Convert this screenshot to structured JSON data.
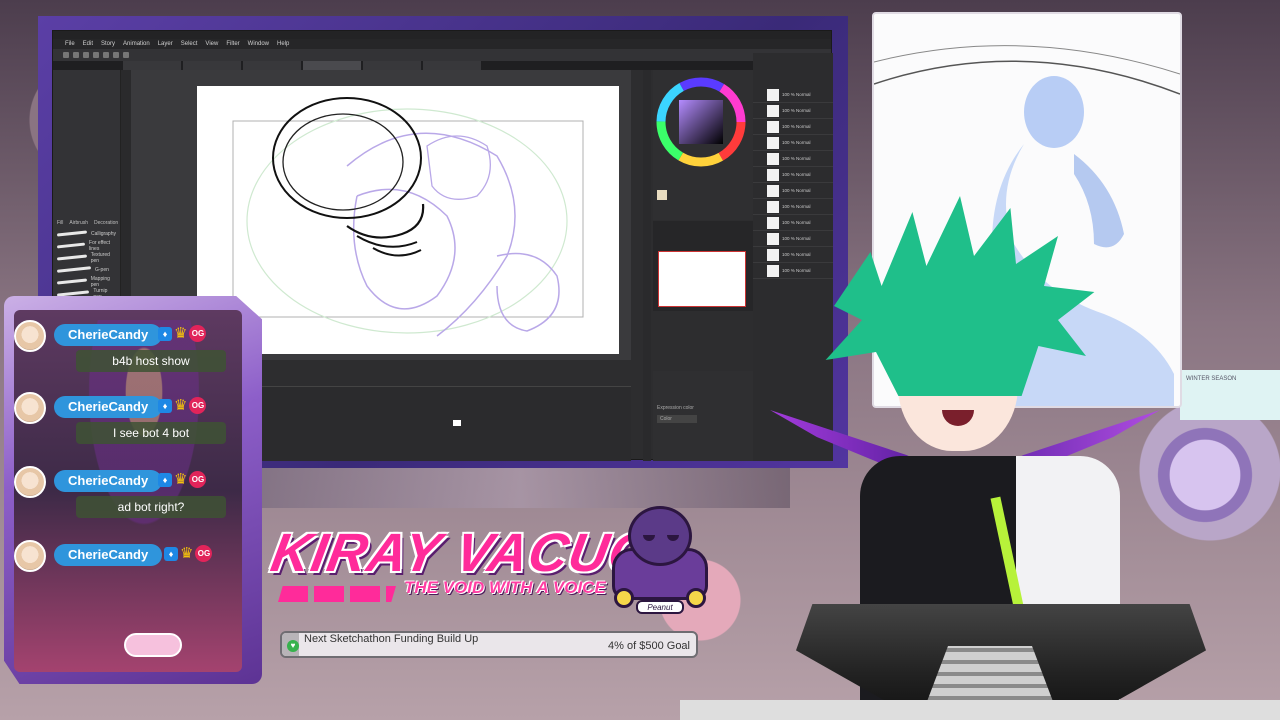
{
  "app": {
    "menu": [
      "File",
      "Edit",
      "Story",
      "Animation",
      "Layer",
      "Select",
      "View",
      "Filter",
      "Window",
      "Help"
    ],
    "tool_property": [
      "Fill",
      "Airbrush",
      "Decoration"
    ],
    "brushes": [
      "Calligraphy",
      "For effect lines",
      "Textured pen",
      "G-pen",
      "Mapping pen",
      "Turnip pen"
    ],
    "layer_row_text": "100 % Normal",
    "property_title": "Expression color",
    "property_value": "Color"
  },
  "chat": {
    "messages": [
      {
        "user": "CherieCandy",
        "text": "b4b host show"
      },
      {
        "user": "CherieCandy",
        "text": "I see bot 4 bot"
      },
      {
        "user": "CherieCandy",
        "text": "ad bot right?"
      },
      {
        "user": "CherieCandy",
        "text": ""
      }
    ],
    "badge_og": "OG"
  },
  "logo": {
    "title": "KIRAY VACUO",
    "subtitle": "THE VOID WITH A VOICE",
    "mascot_plate": "Peanut"
  },
  "goal": {
    "label": "Next Sketchathon Funding Build Up",
    "progress_text": "4% of $500 Goal",
    "percent": 4
  },
  "poster_right": {
    "text": "WINTER SEASON"
  },
  "colors": {
    "accent_pink": "#ff2b9a",
    "accent_purple": "#5b3fa6",
    "chat_name_blue": "#2f95dc",
    "goal_green": "#37b24d"
  }
}
